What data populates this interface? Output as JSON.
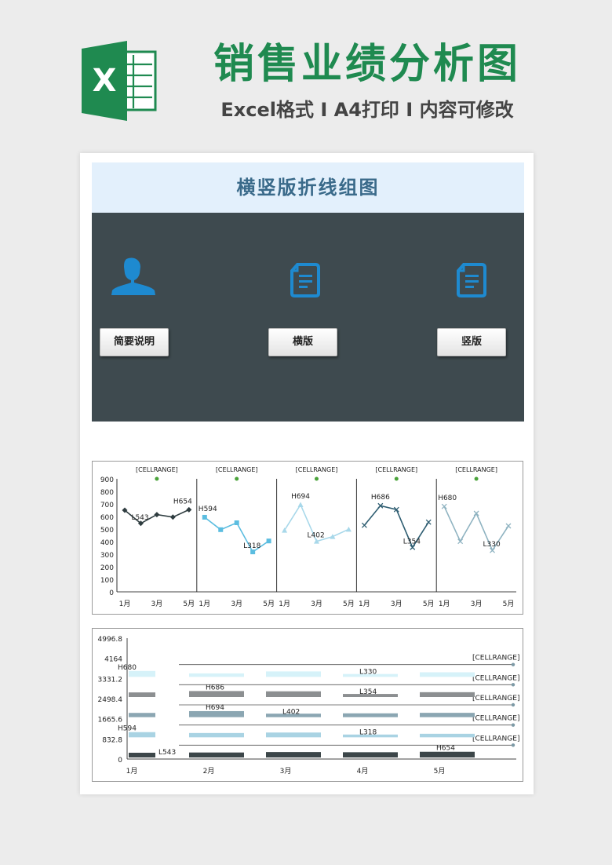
{
  "header": {
    "title": "销售业绩分析图",
    "subtitle": "Excel格式 I A4打印 I 内容可修改",
    "logo_letter": "X"
  },
  "banner": {
    "title": "横竖版折线组图"
  },
  "panel": {
    "buttons": [
      {
        "label": "简要说明",
        "icon": "user-icon"
      },
      {
        "label": "横版",
        "icon": "document-icon"
      },
      {
        "label": "竖版",
        "icon": "document-icon"
      }
    ]
  },
  "colors": {
    "brand_green": "#1f8a50",
    "banner_bg": "#e3f0fc",
    "panel_bg": "#3e4a4f",
    "icon_blue": "#1e8ad0"
  },
  "chart_data": [
    {
      "type": "line",
      "layout": "small-multiples",
      "x": [
        "1月",
        "2月",
        "3月",
        "4月",
        "5月"
      ],
      "x_tick_labels": [
        "1月",
        "3月",
        "5月"
      ],
      "ylim": [
        0,
        900
      ],
      "yticks": [
        0,
        100,
        200,
        300,
        400,
        500,
        600,
        700,
        800,
        900
      ],
      "series_label": "[CELLRANGE]",
      "series": [
        {
          "values": [
            650,
            545,
            615,
            595,
            654
          ],
          "color": "#2f3d40",
          "marker": "diamond",
          "high_label": "H654",
          "low_label": "L543",
          "high_index": 4,
          "low_index": 1
        },
        {
          "values": [
            594,
            495,
            550,
            318,
            405
          ],
          "color": "#5bbde0",
          "marker": "square",
          "high_label": "H594",
          "low_label": "L318",
          "high_index": 0,
          "low_index": 3
        },
        {
          "values": [
            490,
            694,
            402,
            440,
            498
          ],
          "color": "#a8d8ea",
          "marker": "triangle",
          "high_label": "H694",
          "low_label": "L402",
          "high_index": 1,
          "low_index": 2
        },
        {
          "values": [
            530,
            686,
            655,
            354,
            555
          ],
          "color": "#2f5e72",
          "marker": "x",
          "high_label": "H686",
          "low_label": "L354",
          "high_index": 1,
          "low_index": 3
        },
        {
          "values": [
            680,
            402,
            625,
            330,
            525
          ],
          "color": "#8fb3c1",
          "marker": "x",
          "high_label": "H680",
          "low_label": "L330",
          "high_index": 0,
          "low_index": 3
        }
      ]
    },
    {
      "type": "bar",
      "layout": "stacked-floating",
      "categories": [
        "1月",
        "2月",
        "3月",
        "4月",
        "5月"
      ],
      "ylim": [
        0,
        4996.8
      ],
      "yticks": [
        "0",
        "832.8",
        "1665.6",
        "2498.4",
        "3331.2",
        "4164",
        "4996.8"
      ],
      "band_size": 832.8,
      "series_label": "[CELLRANGE]",
      "series": [
        {
          "values": [
            543,
            570,
            620,
            600,
            654
          ],
          "color": "#3c4649",
          "high_label": "H654",
          "low_label": "L543",
          "high_index": 4,
          "low_index": 0
        },
        {
          "values": [
            594,
            495,
            550,
            318,
            405
          ],
          "color": "#a9d3e3",
          "high_label": "H594",
          "low_label": "L318",
          "high_index": 0,
          "low_index": 3
        },
        {
          "values": [
            490,
            694,
            402,
            440,
            498
          ],
          "color": "#8ba6b2",
          "high_label": "H694",
          "low_label": "L402",
          "high_index": 1,
          "low_index": 2
        },
        {
          "values": [
            530,
            686,
            655,
            354,
            555
          ],
          "color": "#8c8f91",
          "high_label": "H686",
          "low_label": "L354",
          "high_index": 1,
          "low_index": 3
        },
        {
          "values": [
            680,
            402,
            625,
            330,
            525
          ],
          "color": "#d6f2f9",
          "high_label": "H680",
          "low_label": "L330",
          "high_index": 0,
          "low_index": 3
        }
      ]
    }
  ]
}
